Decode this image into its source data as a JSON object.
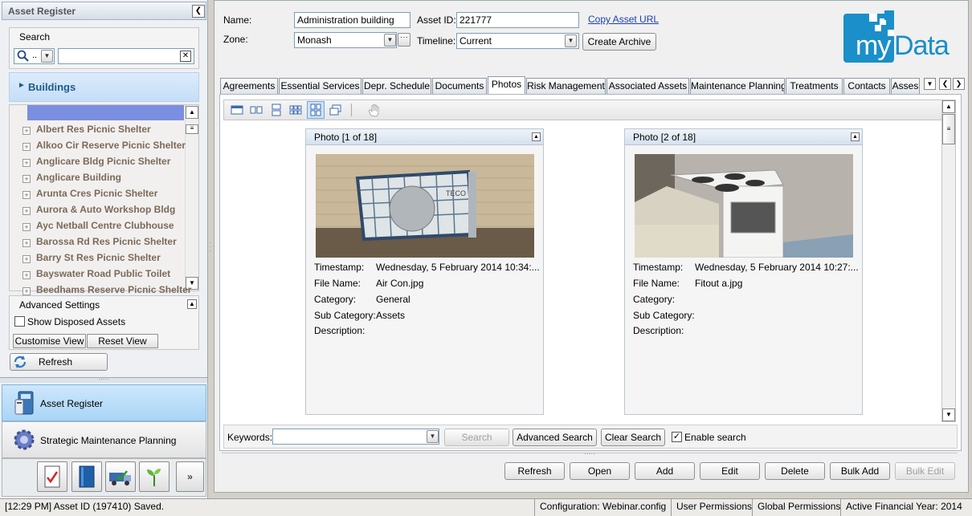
{
  "left_panel": {
    "title": "Asset Register",
    "search": {
      "label": "Search",
      "mode_value": "..",
      "query": ""
    },
    "category": "Buildings",
    "tree_items": [
      "Albert Res Picnic Shelter",
      "Alkoo Cir Reserve Picnic Shelter",
      "Anglicare Bldg Picnic Shelter",
      "Anglicare Building",
      "Arunta Cres Picnic Shelter",
      "Aurora & Auto Workshop Bldg",
      "Ayc Netball Centre Clubhouse",
      "Barossa Rd Res Picnic Shelter",
      "Barry St Res Picnic Shelter",
      "Bayswater Road Public Toilet",
      "Beedhams Reserve Picnic Shelter"
    ],
    "advanced_settings": {
      "title": "Advanced Settings",
      "show_disposed_label": "Show Disposed Assets",
      "show_disposed_checked": false,
      "customise_view": "Customise View",
      "reset_view": "Reset View"
    },
    "refresh": "Refresh",
    "nav": [
      {
        "label": "Asset Register",
        "active": true
      },
      {
        "label": "Strategic Maintenance Planning",
        "active": false
      }
    ],
    "toolbar_icons": [
      "checklist-icon",
      "book-icon",
      "truck-icon",
      "plant-icon",
      "more-icon"
    ]
  },
  "header": {
    "name_label": "Name:",
    "name_value": "Administration building",
    "asset_id_label": "Asset ID:",
    "asset_id_value": "221777",
    "copy_url": "Copy Asset URL",
    "zone_label": "Zone:",
    "zone_value": "Monash",
    "timeline_label": "Timeline:",
    "timeline_value": "Current",
    "create_archive": "Create Archive",
    "logo_text": "myData"
  },
  "tabs": [
    {
      "label": "Agreements",
      "active": false
    },
    {
      "label": "Essential Services",
      "active": false
    },
    {
      "label": "Depr. Schedule",
      "active": false
    },
    {
      "label": "Documents",
      "active": false
    },
    {
      "label": "Photos",
      "active": true
    },
    {
      "label": "Risk Management",
      "active": false
    },
    {
      "label": "Associated Assets",
      "active": false
    },
    {
      "label": "Maintenance Planning",
      "active": false
    },
    {
      "label": "Treatments",
      "active": false
    },
    {
      "label": "Contacts",
      "active": false
    },
    {
      "label": "Asses",
      "active": false
    }
  ],
  "photos": [
    {
      "header": "Photo [1 of 18]",
      "timestamp_label": "Timestamp:",
      "timestamp": "Wednesday, 5 February 2014 10:34:...",
      "file_name_label": "File Name:",
      "file_name": "Air Con.jpg",
      "category_label": "Category:",
      "category": "General",
      "sub_category_label": "Sub Category:",
      "sub_category": "Assets",
      "description_label": "Description:",
      "description": ""
    },
    {
      "header": "Photo [2 of 18]",
      "timestamp_label": "Timestamp:",
      "timestamp": "Wednesday, 5 February 2014 10:27:...",
      "file_name_label": "File Name:",
      "file_name": "Fitout a.jpg",
      "category_label": "Category:",
      "category": "",
      "sub_category_label": "Sub Category:",
      "sub_category": "",
      "description_label": "Description:",
      "description": ""
    }
  ],
  "search_bar": {
    "keywords_label": "Keywords:",
    "keywords_value": "",
    "search": "Search",
    "advanced_search": "Advanced Search",
    "clear_search": "Clear Search",
    "enable_search": "Enable search",
    "enable_search_checked": true
  },
  "actions": {
    "refresh": "Refresh",
    "open": "Open",
    "add": "Add",
    "edit": "Edit",
    "delete": "Delete",
    "bulk_add": "Bulk Add",
    "bulk_edit": "Bulk Edit"
  },
  "status_bar": {
    "message": "[12:29 PM] Asset ID (197410) Saved.",
    "configuration": "Configuration: Webinar.config",
    "user_permissions": "User Permissions",
    "global_permissions": "Global Permissions",
    "financial_year": "Active Financial Year: 2014"
  },
  "colors": {
    "accent": "#1a8fc9",
    "selection": "#7b8fe0",
    "nav_active": "#b7dcf7"
  }
}
